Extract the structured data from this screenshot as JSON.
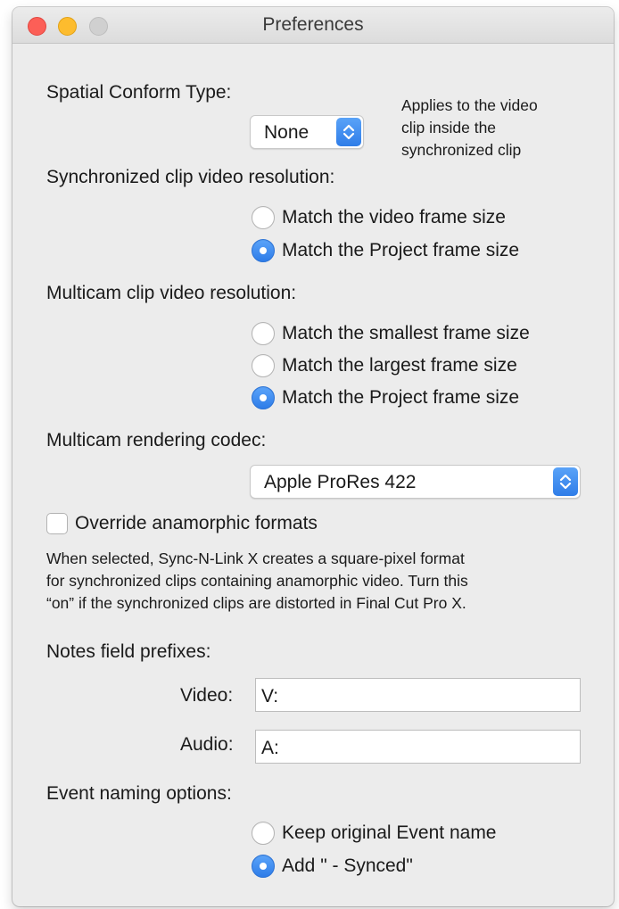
{
  "window": {
    "title": "Preferences"
  },
  "spatial": {
    "label": "Spatial Conform Type:",
    "value": "None",
    "note": [
      "Applies to the video",
      "clip inside the",
      "synchronized clip"
    ]
  },
  "sync_resolution": {
    "label": "Synchronized clip video resolution:",
    "options": [
      {
        "label": "Match the video frame size",
        "selected": false
      },
      {
        "label": "Match the Project frame size",
        "selected": true
      }
    ]
  },
  "multicam_resolution": {
    "label": "Multicam clip video resolution:",
    "options": [
      {
        "label": "Match the smallest frame size",
        "selected": false
      },
      {
        "label": "Match the largest frame size",
        "selected": false
      },
      {
        "label": "Match the Project frame size",
        "selected": true
      }
    ]
  },
  "codec": {
    "label": "Multicam rendering codec:",
    "value": "Apple ProRes 422"
  },
  "anamorphic": {
    "label": "Override anamorphic formats",
    "checked": false,
    "description": [
      "When selected, Sync-N-Link X creates a square-pixel format",
      "for synchronized clips containing anamorphic video. Turn this",
      "“on” if the synchronized clips are distorted in Final Cut Pro X."
    ]
  },
  "notes": {
    "label": "Notes field prefixes:",
    "video_label": "Video:",
    "video_value": "V:",
    "audio_label": "Audio:",
    "audio_value": "A:"
  },
  "event_naming": {
    "label": "Event naming options:",
    "options": [
      {
        "label": "Keep original Event name",
        "selected": false
      },
      {
        "label": "Add \" - Synced\"",
        "selected": true
      }
    ]
  },
  "colors": {
    "accent": "#3b8cf2",
    "window_bg": "#ececec"
  }
}
